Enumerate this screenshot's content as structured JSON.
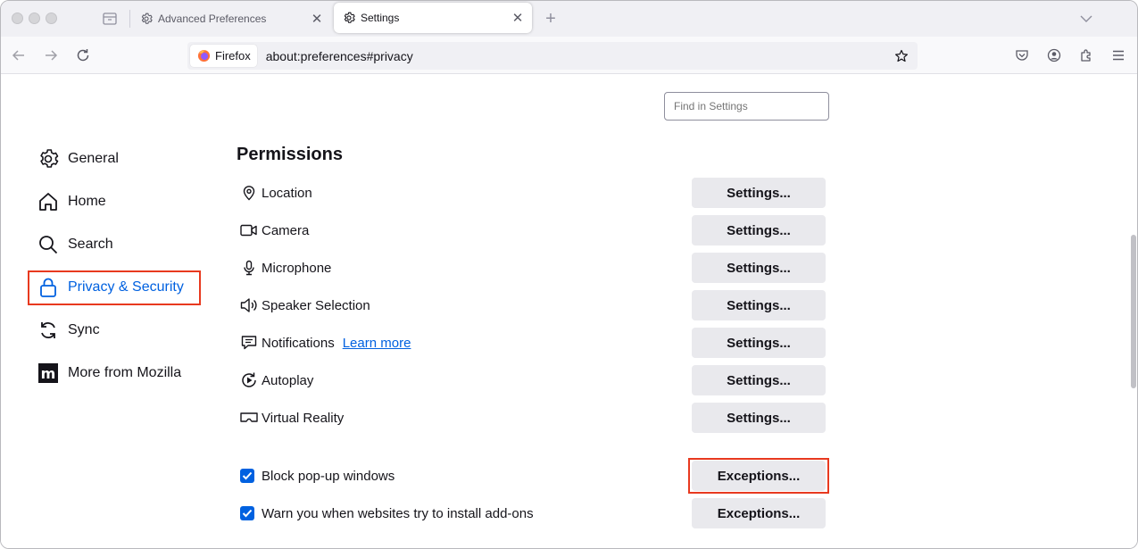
{
  "tabs": [
    {
      "title": "Advanced Preferences",
      "icon": "gear-icon",
      "active": false
    },
    {
      "title": "Settings",
      "icon": "gear-icon",
      "active": true
    }
  ],
  "newtab_label": "+",
  "urlbar": {
    "identity_label": "Firefox",
    "url": "about:preferences#privacy"
  },
  "search": {
    "placeholder": "Find in Settings"
  },
  "categories": [
    {
      "label": "General",
      "icon": "gear-icon"
    },
    {
      "label": "Home",
      "icon": "home-icon"
    },
    {
      "label": "Search",
      "icon": "search-icon"
    },
    {
      "label": "Privacy & Security",
      "icon": "lock-icon",
      "selected": true
    },
    {
      "label": "Sync",
      "icon": "sync-icon"
    },
    {
      "label": "More from Mozilla",
      "icon": "mozilla-logo-icon"
    }
  ],
  "permissions": {
    "title": "Permissions",
    "rows": [
      {
        "label": "Location",
        "icon": "location-icon",
        "button": "Settings..."
      },
      {
        "label": "Camera",
        "icon": "camera-icon",
        "button": "Settings..."
      },
      {
        "label": "Microphone",
        "icon": "microphone-icon",
        "button": "Settings..."
      },
      {
        "label": "Speaker Selection",
        "icon": "speaker-icon",
        "button": "Settings..."
      },
      {
        "label": "Notifications",
        "icon": "notification-icon",
        "button": "Settings...",
        "link": "Learn more"
      },
      {
        "label": "Autoplay",
        "icon": "autoplay-icon",
        "button": "Settings..."
      },
      {
        "label": "Virtual Reality",
        "icon": "vr-headset-icon",
        "button": "Settings..."
      }
    ],
    "checks": [
      {
        "label": "Block pop-up windows",
        "checked": true,
        "button": "Exceptions..."
      },
      {
        "label": "Warn you when websites try to install add-ons",
        "checked": true,
        "button": "Exceptions..."
      }
    ]
  },
  "colors": {
    "accent": "#0061e0",
    "highlight": "#e8391f",
    "button_bg": "#e9e9ed"
  }
}
